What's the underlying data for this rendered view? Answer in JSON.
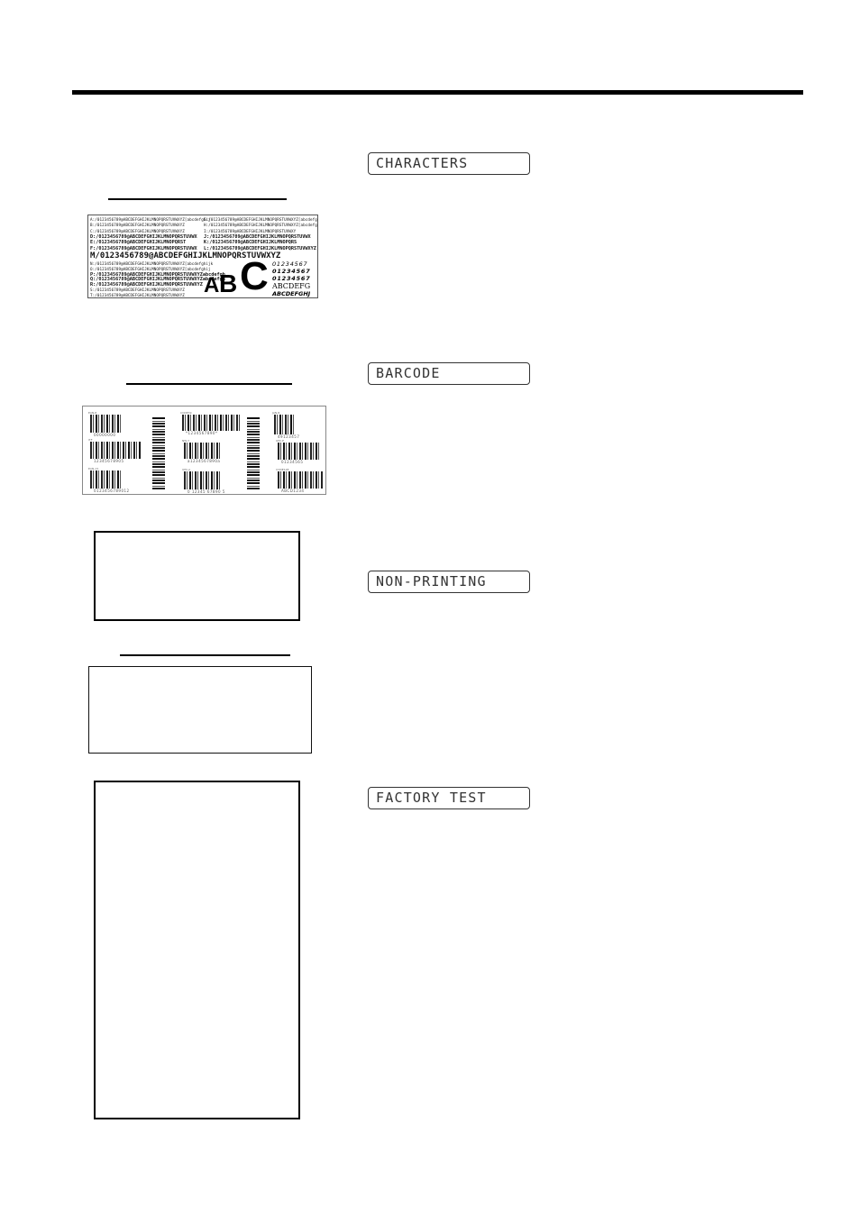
{
  "lcd_messages": {
    "characters": "CHARACTERS",
    "barcode": "BARCODE",
    "non_printing": "NON-PRINTING",
    "factory_test": "FACTORY TEST"
  },
  "character_sample": {
    "rows_left": [
      "A:/0123456789@ABCDEFGHIJKLMNOPQRSTUVWXYZ[abcdefghij",
      "B:/0123456789@ABCDEFGHIJKLMNOPQRSTUVWXYZ",
      "C:/0123456789@ABCDEFGHIJKLMNOPQRSTUVWXYZ",
      "D:/0123456789@ABCDEFGHIJKLMNOPQRSTUVWX",
      "E:/0123456789@ABCDEFGHIJKLMNOPQRST",
      "F:/0123456789@ABCDEFGHIJKLMNOPQRSTUVWX"
    ],
    "row_large": "M/0123456789@ABCDEFGHIJKLMNOPQRSTUVWXYZ",
    "rows_left_lower": [
      "N:/0123456789@ABCDEFGHIJKLMNOPQRSTUVWXYZ[abcdefghijk",
      "O:/0123456789@ABCDEFGHIJKLMNOPQRSTUVWXYZ[abcdefghij",
      "P:/0123456789@ABCDEFGHIJKLMNOPQRSTUVWXYZabcdefgh",
      "Q:/0123456789@ABCDEFGHIJKLMNOPQRSTUVWXYZabcdefgh",
      "R:/0123456789@ABCDEFGHIJKLMNOPQRSTUVWXYZ",
      "S:/0123456789@ABCDEFGHIJKLMNOPQRSTUVWXYZ",
      "T:/0123456789@ABCDEFGHIJKLMNOPQRSTUVWXYZ"
    ],
    "rows_right": [
      "G:/0123456789@ABCDEFGHIJKLMNOPQRSTUVWXYZ[abcdefghijklm",
      "H:/0123456789@ABCDEFGHIJKLMNOPQRSTUVWXYZ[abcdefghij",
      "I:/0123456789@ABCDEFGHIJKLMNOPQRSTUVWXY",
      "J:/0123456789@ABCDEFGHIJKLMNOPQRSTUVWX",
      "K:/0123456789@ABCDEFGHIJKLMNOPQRS",
      "L:/0123456789@ABCDEFGHIJKLMNOPQRSTUVWXYZ"
    ],
    "big_letters": [
      "A",
      "B",
      "C"
    ],
    "digit_rows": [
      "01234567",
      "01234567",
      "01234567"
    ],
    "alpha_rows": [
      "ABCDEFG",
      "ABCDEFGHJ"
    ]
  },
  "barcode_sample": {
    "codes": [
      {
        "caption": "EAN-8",
        "number": "00000000"
      },
      {
        "caption": "CODE39",
        "number": "*1234567890*"
      },
      {
        "caption": "JAN-8",
        "number": "49123457"
      },
      {
        "caption": "ITF",
        "number": "12345678905"
      },
      {
        "caption": "NW-7",
        "number": "a1234567890a"
      },
      {
        "caption": "UPC-E",
        "number": "01234565"
      },
      {
        "caption": "EAN-13",
        "number": "0123456789012"
      },
      {
        "caption": "UPC-A",
        "number": "0 12345 67890 5"
      },
      {
        "caption": "CODE128",
        "number": "ABCD1234"
      }
    ]
  }
}
